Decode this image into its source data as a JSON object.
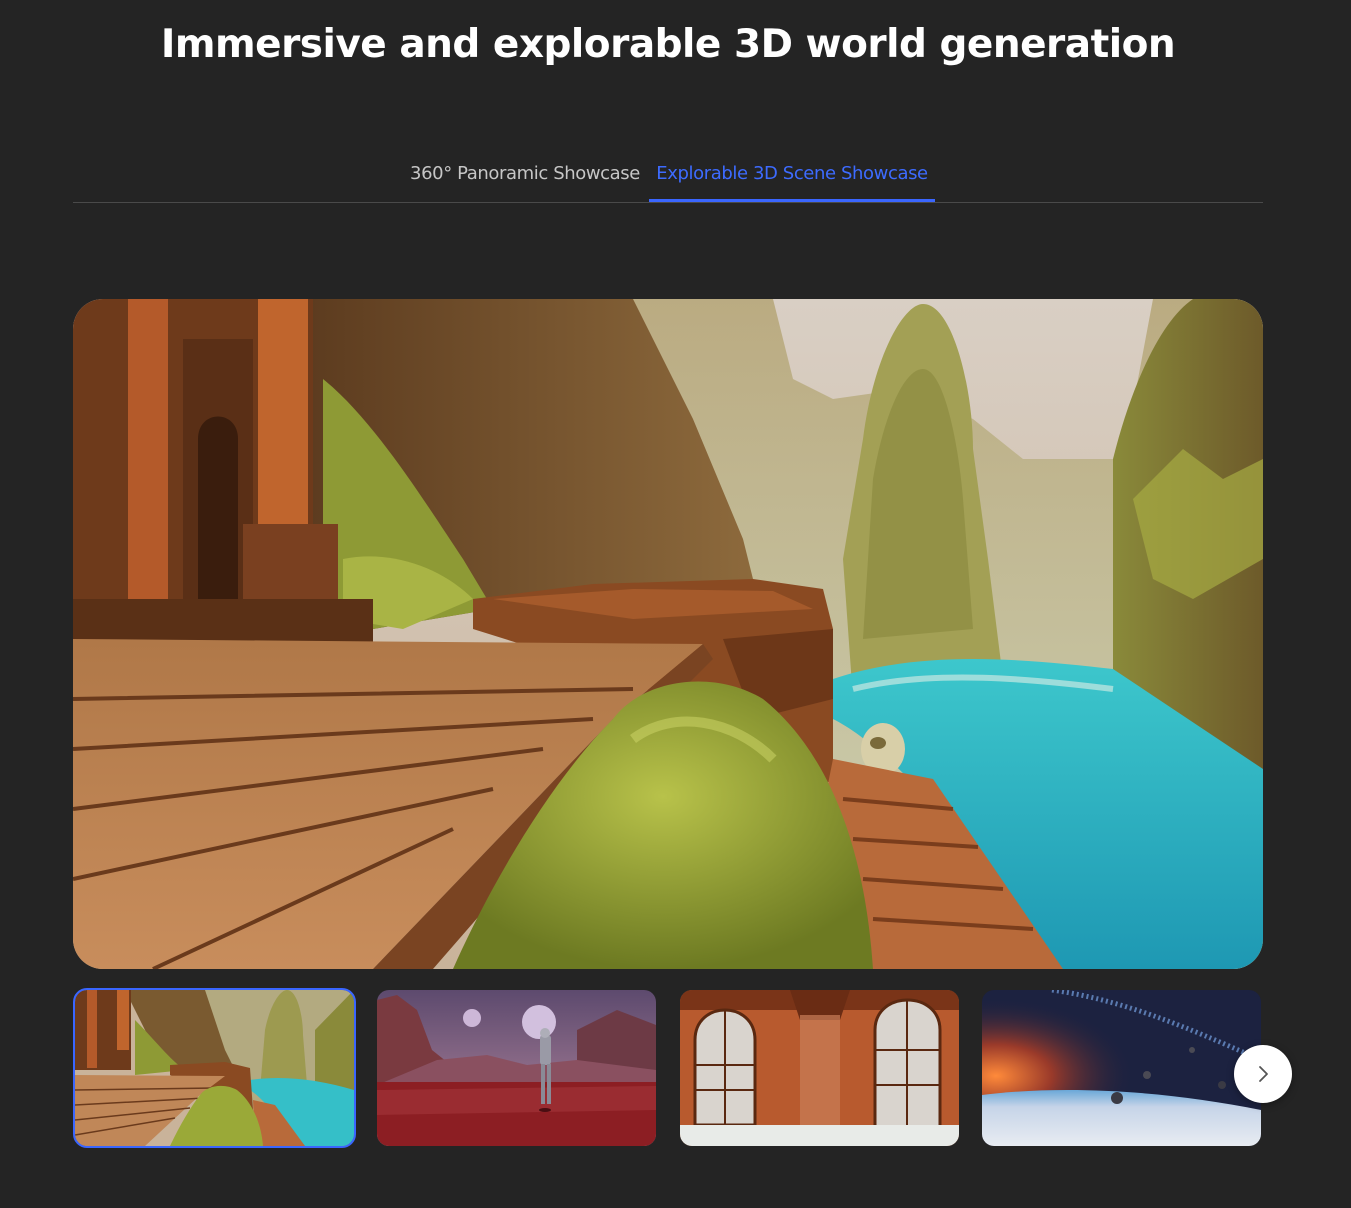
{
  "page": {
    "headline": "Immersive and explorable 3D world generation"
  },
  "tabs": [
    {
      "label": "360° Panoramic Showcase",
      "active": false
    },
    {
      "label": "Explorable 3D Scene Showcase",
      "active": true
    }
  ],
  "colors": {
    "background": "#242424",
    "accent": "#3a66ff",
    "inactive_tab": "#c6c6c6",
    "divider": "#4a4a4a"
  },
  "gallery": {
    "main_scene": "canyon-temple-river-scene",
    "thumbnails": [
      {
        "scene": "canyon-temple-river",
        "selected": true
      },
      {
        "scene": "red-planet-astronaut",
        "selected": false
      },
      {
        "scene": "gothic-interior-windows",
        "selected": false
      },
      {
        "scene": "space-asteroid-field",
        "selected": false
      }
    ],
    "next_icon": "chevron-right-icon"
  }
}
